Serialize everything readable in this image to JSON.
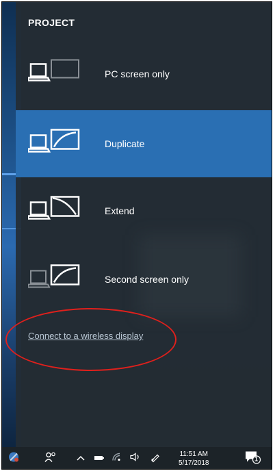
{
  "panel": {
    "title": "PROJECT",
    "options": [
      {
        "label": "PC screen only",
        "icon": "pc-screen-only-icon",
        "selected": false
      },
      {
        "label": "Duplicate",
        "icon": "duplicate-icon",
        "selected": true
      },
      {
        "label": "Extend",
        "icon": "extend-icon",
        "selected": false
      },
      {
        "label": "Second screen only",
        "icon": "second-screen-only-icon",
        "selected": false
      }
    ],
    "connect_link": "Connect to a wireless display"
  },
  "taskbar": {
    "time": "11:51 AM",
    "date": "5/17/2018",
    "notification_count": "1"
  },
  "colors": {
    "selected": "#2a6fb3",
    "panel": "#242c34",
    "annotation": "#e0201c"
  }
}
